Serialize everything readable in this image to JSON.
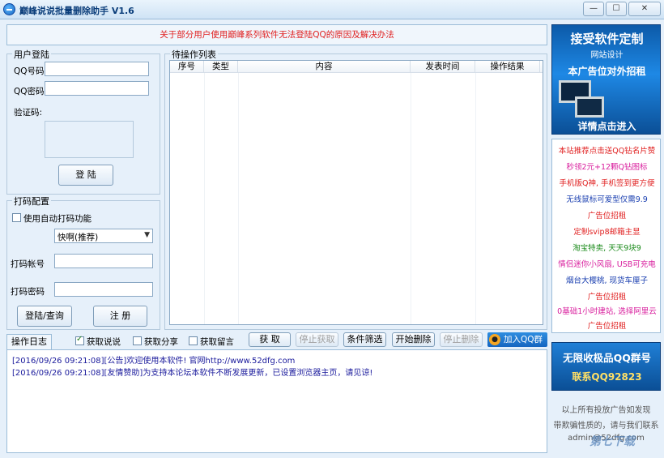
{
  "window": {
    "title": "巅峰说说批量删除助手 V1.6",
    "minimize": "—",
    "maximize": "☐",
    "close": "✕"
  },
  "notice": "关于部分用户使用巅峰系列软件无法登陆QQ的原因及解决办法",
  "login": {
    "group_title": "用户登陆",
    "qq_label": "QQ号码:",
    "qq_value": "",
    "pwd_label": "QQ密码:",
    "pwd_value": "",
    "captcha_label": "验证码:",
    "login_button": "登  陆"
  },
  "captcha_config": {
    "group_title": "打码配置",
    "auto_label": "使用自动打码功能",
    "auto_checked": false,
    "service_selected": "快啊(推荐)",
    "account_label": "打码帐号",
    "account_value": "",
    "password_label": "打码密码",
    "password_value": "",
    "login_query_button": "登陆/查询",
    "register_button": "注  册"
  },
  "task_list": {
    "group_title": "待操作列表",
    "columns": [
      "序号",
      "类型",
      "内容",
      "发表时间",
      "操作结果"
    ],
    "rows": []
  },
  "toolbar": {
    "tab_log": "操作日志",
    "get_shuoshuo": "获取说说",
    "get_shuoshuo_checked": true,
    "get_share": "获取分享",
    "get_share_checked": false,
    "get_comments": "获取留言",
    "get_comments_checked": false,
    "fetch_button": "获  取",
    "stop_fetch_button": "停止获取",
    "filter_button": "条件筛选",
    "start_delete_button": "开始删除",
    "stop_delete_button": "停止删除",
    "join_qq_group": "加入QQ群"
  },
  "log": {
    "lines": [
      "[2016/09/26 09:21:08][公告]欢迎使用本软件! 官网http://www.52dfg.com",
      "[2016/09/26 09:21:08][友情赞助]为支持本论坛本软件不断发展更新，已设置浏览器主页，请见谅!"
    ]
  },
  "ads": {
    "top_banner": {
      "line1": "接受软件定制",
      "line2": "网站设计",
      "line3": "本广告位对外招租",
      "line4": "详情点击进入"
    },
    "items": [
      {
        "text": "本站推荐点击送QQ钻名片赞",
        "color": "#e01e1e"
      },
      {
        "text": "秒领2元+12颗Q钻图标",
        "color": "#d81b9c"
      },
      {
        "text": "手机版Q神, 手机签到更方便",
        "color": "#e01e1e"
      },
      {
        "text": "无线鼠标可爱型仅需9.9",
        "color": "#1a3fb0"
      },
      {
        "text": "广告位招租",
        "color": "#e01e1e"
      },
      {
        "text": "定制svip8邮箱主显",
        "color": "#e01e1e"
      },
      {
        "text": "淘宝特卖, 天天9块9",
        "color": "#1a8a1a"
      },
      {
        "text": "情侣迷你小风扇, USB可充电",
        "color": "#d81b9c"
      },
      {
        "text": "烟台大樱桃, 现货车厘子",
        "color": "#1a3fb0"
      },
      {
        "text": "广告位招租",
        "color": "#e01e1e"
      },
      {
        "text": "0基础1小时建站, 选择阿里云",
        "color": "#d81b9c"
      },
      {
        "text": "广告位招租",
        "color": "#e01e1e"
      }
    ],
    "qq_banner": {
      "line1": "无限收极品QQ群号",
      "line2": "联系QQ92823"
    },
    "footer_lines": [
      "以上所有投放广告如发现",
      "带欺骗性质的，请与我们联系",
      "admin@52dfg.com"
    ],
    "watermark": "第七下载"
  }
}
